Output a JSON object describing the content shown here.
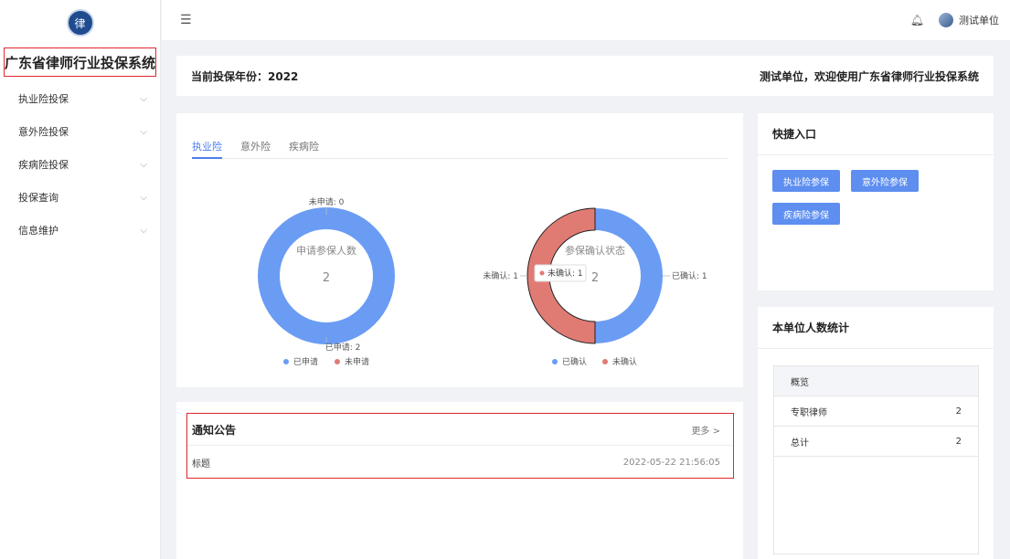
{
  "sidebar": {
    "system_title": "广东省律师行业投保系统",
    "menu": [
      {
        "label": "执业险投保"
      },
      {
        "label": "意外险投保"
      },
      {
        "label": "疾病险投保"
      },
      {
        "label": "投保查询"
      },
      {
        "label": "信息维护"
      }
    ]
  },
  "header": {
    "user_name": "测试单位",
    "fold_icon": "menu-fold-icon",
    "bell_icon": "bell-icon"
  },
  "banner": {
    "year_text": "当前投保年份：2022",
    "welcome_text": "测试单位，欢迎使用广东省律师行业投保系统"
  },
  "tabs": [
    {
      "label": "执业险",
      "active": true
    },
    {
      "label": "意外险",
      "active": false
    },
    {
      "label": "疾病险",
      "active": false
    }
  ],
  "colors": {
    "blue": "#6b9cf4",
    "red": "#e07b74",
    "accent": "#4a7ef0"
  },
  "chart_data": [
    {
      "type": "pie",
      "title": "申请参保人数",
      "total": "2",
      "slices": [
        {
          "name": "已申请",
          "value": 2,
          "label": "已申请: 2"
        },
        {
          "name": "未申请",
          "value": 0,
          "label": "未申请: 0"
        }
      ],
      "legend": [
        "已申请",
        "未申请"
      ],
      "legend_position": "bottom"
    },
    {
      "type": "pie",
      "title": "参保确认状态",
      "total": "2",
      "slices": [
        {
          "name": "已确认",
          "value": 1,
          "label": "已确认: 1"
        },
        {
          "name": "未确认",
          "value": 1,
          "label": "未确认: 1"
        }
      ],
      "tooltip": "未确认: 1",
      "legend": [
        "已确认",
        "未确认"
      ],
      "legend_position": "bottom"
    }
  ],
  "quick": {
    "title": "快捷入口",
    "buttons": [
      "执业险参保",
      "意外险参保",
      "疾病险参保"
    ]
  },
  "stats": {
    "title": "本单位人数统计",
    "header": "概览",
    "rows": [
      {
        "label": "专职律师",
        "value": "2"
      },
      {
        "label": "总计",
        "value": "2"
      }
    ]
  },
  "notice": {
    "title": "通知公告",
    "more": "更多 >",
    "items": [
      {
        "title": "标题",
        "date": "2022-05-22 21:56:05"
      }
    ]
  }
}
